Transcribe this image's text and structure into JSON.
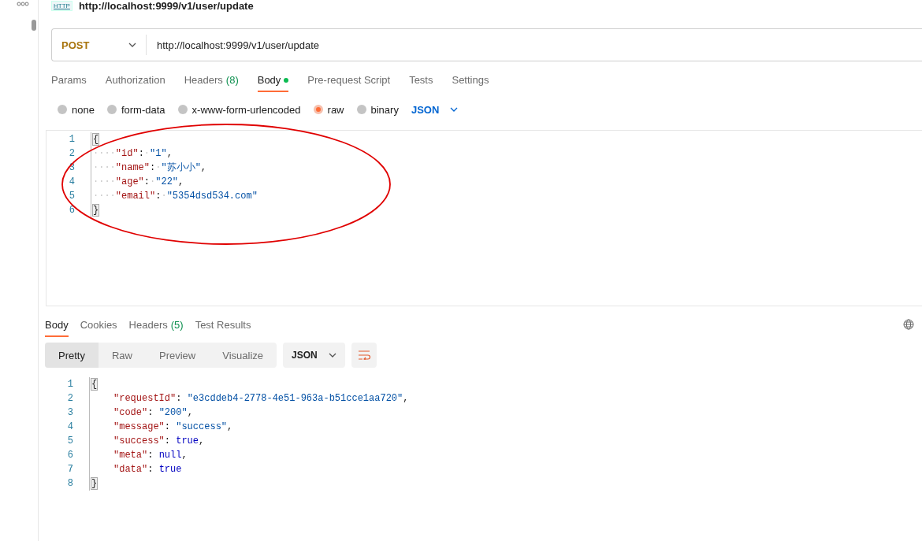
{
  "header": {
    "badge": "HTTP",
    "title": "http://localhost:9999/v1/user/update"
  },
  "request": {
    "method": "POST",
    "url": "http://localhost:9999/v1/user/update"
  },
  "request_tabs": [
    {
      "label": "Params",
      "dot": false,
      "selected": false
    },
    {
      "label": "Authorization",
      "dot": false,
      "selected": false
    },
    {
      "label": "Headers",
      "count": "(8)",
      "dot": false,
      "selected": false
    },
    {
      "label": "Body",
      "dot": true,
      "selected": true
    },
    {
      "label": "Pre-request Script",
      "dot": false,
      "selected": false
    },
    {
      "label": "Tests",
      "dot": false,
      "selected": false
    },
    {
      "label": "Settings",
      "dot": false,
      "selected": false
    }
  ],
  "body_types": [
    {
      "label": "none",
      "selected": false
    },
    {
      "label": "form-data",
      "selected": false
    },
    {
      "label": "x-www-form-urlencoded",
      "selected": false
    },
    {
      "label": "raw",
      "selected": true
    },
    {
      "label": "binary",
      "selected": false
    }
  ],
  "body_format": "JSON",
  "request_body": [
    {
      "number": "1",
      "tokens": [
        {
          "kind": "brace",
          "text": "{"
        }
      ]
    },
    {
      "number": "2",
      "tokens": [
        {
          "kind": "space",
          "text": "····"
        },
        {
          "kind": "key",
          "text": "\"id\""
        },
        {
          "kind": "punct",
          "text": ":"
        },
        {
          "kind": "space",
          "text": "·"
        },
        {
          "kind": "string",
          "text": "\"1\""
        },
        {
          "kind": "punct",
          "text": ","
        }
      ]
    },
    {
      "number": "3",
      "tokens": [
        {
          "kind": "space",
          "text": "····"
        },
        {
          "kind": "key",
          "text": "\"name\""
        },
        {
          "kind": "punct",
          "text": ":"
        },
        {
          "kind": "space",
          "text": "·"
        },
        {
          "kind": "string",
          "text": "\"苏小小\""
        },
        {
          "kind": "punct",
          "text": ","
        }
      ]
    },
    {
      "number": "4",
      "tokens": [
        {
          "kind": "space",
          "text": "····"
        },
        {
          "kind": "key",
          "text": "\"age\""
        },
        {
          "kind": "punct",
          "text": ":"
        },
        {
          "kind": "space",
          "text": "·"
        },
        {
          "kind": "string",
          "text": "\"22\""
        },
        {
          "kind": "punct",
          "text": ","
        }
      ]
    },
    {
      "number": "5",
      "tokens": [
        {
          "kind": "space",
          "text": "····"
        },
        {
          "kind": "key",
          "text": "\"email\""
        },
        {
          "kind": "punct",
          "text": ":"
        },
        {
          "kind": "space",
          "text": "·"
        },
        {
          "kind": "string",
          "text": "\"5354dsd534.com\""
        }
      ]
    },
    {
      "number": "6",
      "tokens": [
        {
          "kind": "brace",
          "text": "}"
        }
      ]
    }
  ],
  "annotations": [
    {
      "kind": "ellipse"
    }
  ],
  "response_tabs": [
    {
      "label": "Body",
      "selected": true
    },
    {
      "label": "Cookies",
      "selected": false
    },
    {
      "label": "Headers",
      "count": "(5)",
      "selected": false
    },
    {
      "label": "Test Results",
      "selected": false
    }
  ],
  "view_modes": [
    {
      "label": "Pretty",
      "selected": true
    },
    {
      "label": "Raw",
      "selected": false
    },
    {
      "label": "Preview",
      "selected": false
    },
    {
      "label": "Visualize",
      "selected": false
    }
  ],
  "response_format": "JSON",
  "response_body": [
    {
      "number": "1",
      "tokens": [
        {
          "kind": "brace",
          "text": "{"
        }
      ]
    },
    {
      "number": "2",
      "indent": true,
      "tokens": [
        {
          "kind": "key",
          "text": "\"requestId\""
        },
        {
          "kind": "punct",
          "text": ": "
        },
        {
          "kind": "string",
          "text": "\"e3cddeb4-2778-4e51-963a-b51cce1aa720\""
        },
        {
          "kind": "punct",
          "text": ","
        }
      ]
    },
    {
      "number": "3",
      "indent": true,
      "tokens": [
        {
          "kind": "key",
          "text": "\"code\""
        },
        {
          "kind": "punct",
          "text": ": "
        },
        {
          "kind": "string",
          "text": "\"200\""
        },
        {
          "kind": "punct",
          "text": ","
        }
      ]
    },
    {
      "number": "4",
      "indent": true,
      "tokens": [
        {
          "kind": "key",
          "text": "\"message\""
        },
        {
          "kind": "punct",
          "text": ": "
        },
        {
          "kind": "string",
          "text": "\"success\""
        },
        {
          "kind": "punct",
          "text": ","
        }
      ]
    },
    {
      "number": "5",
      "indent": true,
      "tokens": [
        {
          "kind": "key",
          "text": "\"success\""
        },
        {
          "kind": "punct",
          "text": ": "
        },
        {
          "kind": "literal",
          "text": "true"
        },
        {
          "kind": "punct",
          "text": ","
        }
      ]
    },
    {
      "number": "6",
      "indent": true,
      "tokens": [
        {
          "kind": "key",
          "text": "\"meta\""
        },
        {
          "kind": "punct",
          "text": ": "
        },
        {
          "kind": "literal",
          "text": "null"
        },
        {
          "kind": "punct",
          "text": ","
        }
      ]
    },
    {
      "number": "7",
      "indent": true,
      "tokens": [
        {
          "kind": "key",
          "text": "\"data\""
        },
        {
          "kind": "punct",
          "text": ": "
        },
        {
          "kind": "literal",
          "text": "true"
        }
      ]
    },
    {
      "number": "8",
      "tokens": [
        {
          "kind": "brace",
          "text": "}"
        }
      ]
    }
  ]
}
